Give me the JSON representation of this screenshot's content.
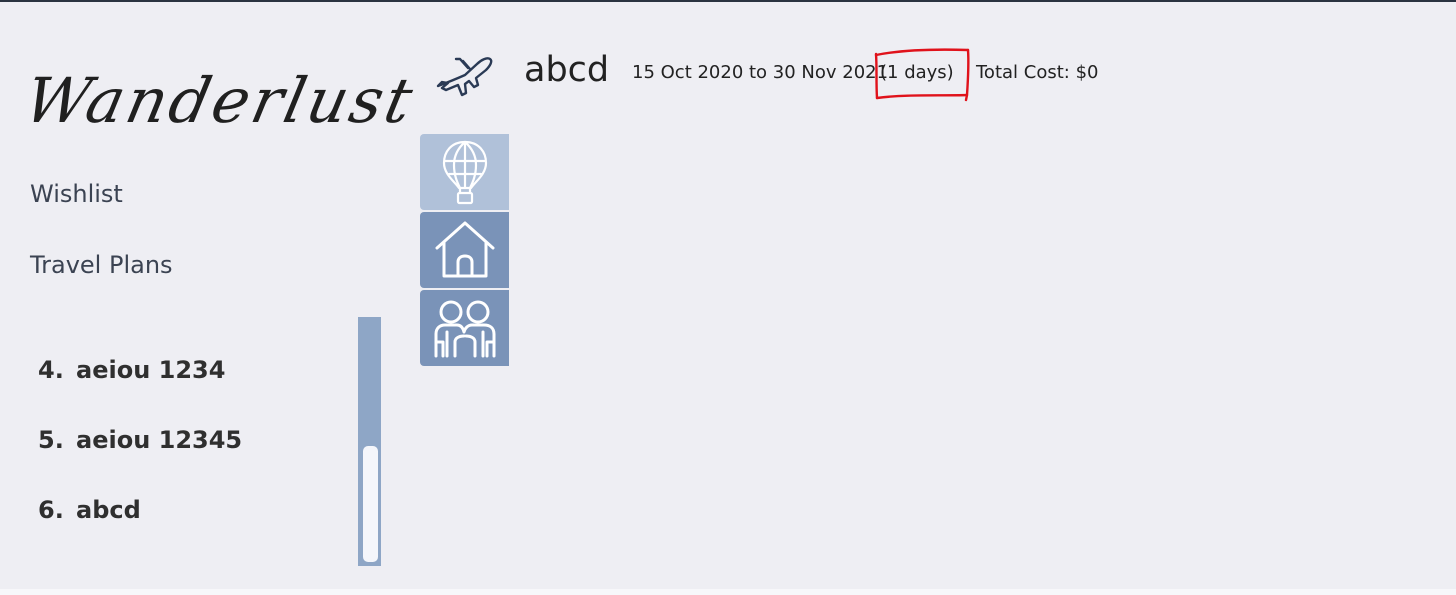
{
  "app": {
    "logo_text": "Wanderlust"
  },
  "sidebar": {
    "nav": [
      {
        "label": "Wishlist"
      },
      {
        "label": "Travel Plans"
      }
    ],
    "plans": [
      {
        "index": "4.",
        "name": "aeiou 1234"
      },
      {
        "index": "5.",
        "name": "aeiou 12345"
      },
      {
        "index": "6.",
        "name": "abcd"
      }
    ]
  },
  "tabs": [
    {
      "name": "activity",
      "icon": "hot-air-balloon-icon"
    },
    {
      "name": "accommodation",
      "icon": "house-icon"
    },
    {
      "name": "friends",
      "icon": "friends-icon"
    }
  ],
  "header": {
    "icon": "airplane-icon",
    "name": "abcd",
    "dates": "15 Oct 2020 to 30 Nov 2021",
    "days": "(1 days)",
    "cost": "Total Cost: $0"
  },
  "colors": {
    "background": "#eeeef3",
    "tab_active": "#b0c1d9",
    "tab_inactive": "#7a93b8",
    "scrollbar": "#8ea6c6",
    "highlight": "#e0121b"
  }
}
